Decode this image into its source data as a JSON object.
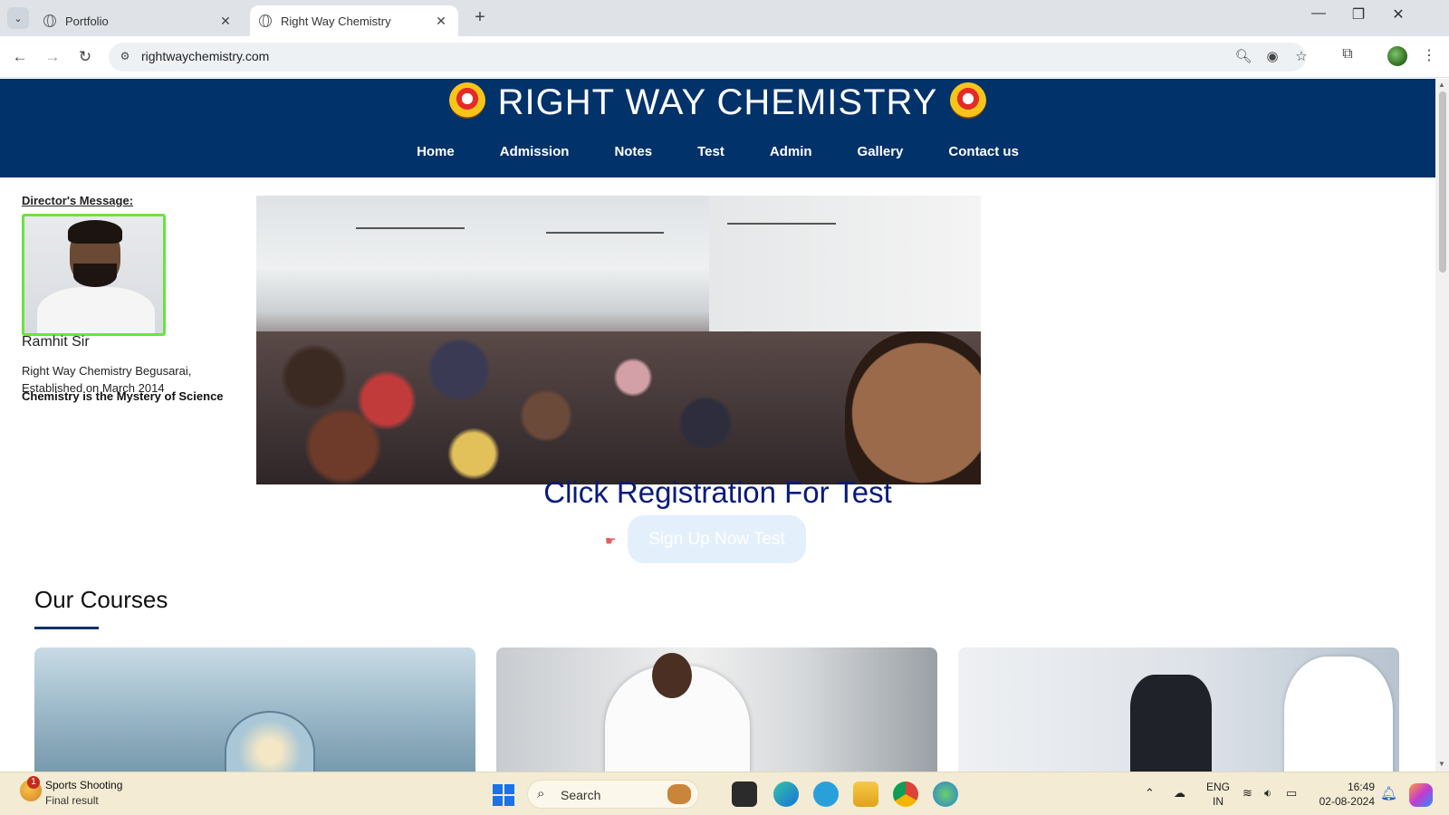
{
  "browser": {
    "tabs": [
      {
        "title": "Portfolio",
        "active": false
      },
      {
        "title": "Right Way Chemistry",
        "active": true
      }
    ],
    "address": "rightwaychemistry.com"
  },
  "site": {
    "brand": "RIGHT WAY CHEMISTRY",
    "nav": [
      "Home",
      "Admission",
      "Notes",
      "Test",
      "Admin",
      "Gallery",
      "Contact us"
    ]
  },
  "director": {
    "title": "Director's Message:",
    "name": "Ramhit Sir",
    "line1": "Right Way Chemistry Begusarai,",
    "line2": "Established on March 2014",
    "motto": "Chemistry is the Mystery of Science"
  },
  "registration": {
    "title": "Click Registration For Test",
    "button": "Sign Up Now Test",
    "pointer": "☛"
  },
  "courses": {
    "title": "Our Courses"
  },
  "taskbar": {
    "news_badge": "1",
    "news_title": "Sports Shooting",
    "news_sub": "Final result",
    "search": "Search",
    "lang_top": "ENG",
    "lang_bottom": "IN",
    "time": "16:49",
    "date": "02-08-2024"
  },
  "colors": {
    "header_bg": "#02326a",
    "registration_title": "#0a1a7a",
    "signup_button_bg": "#e3f0fb",
    "director_photo_border": "#6ae33e"
  }
}
